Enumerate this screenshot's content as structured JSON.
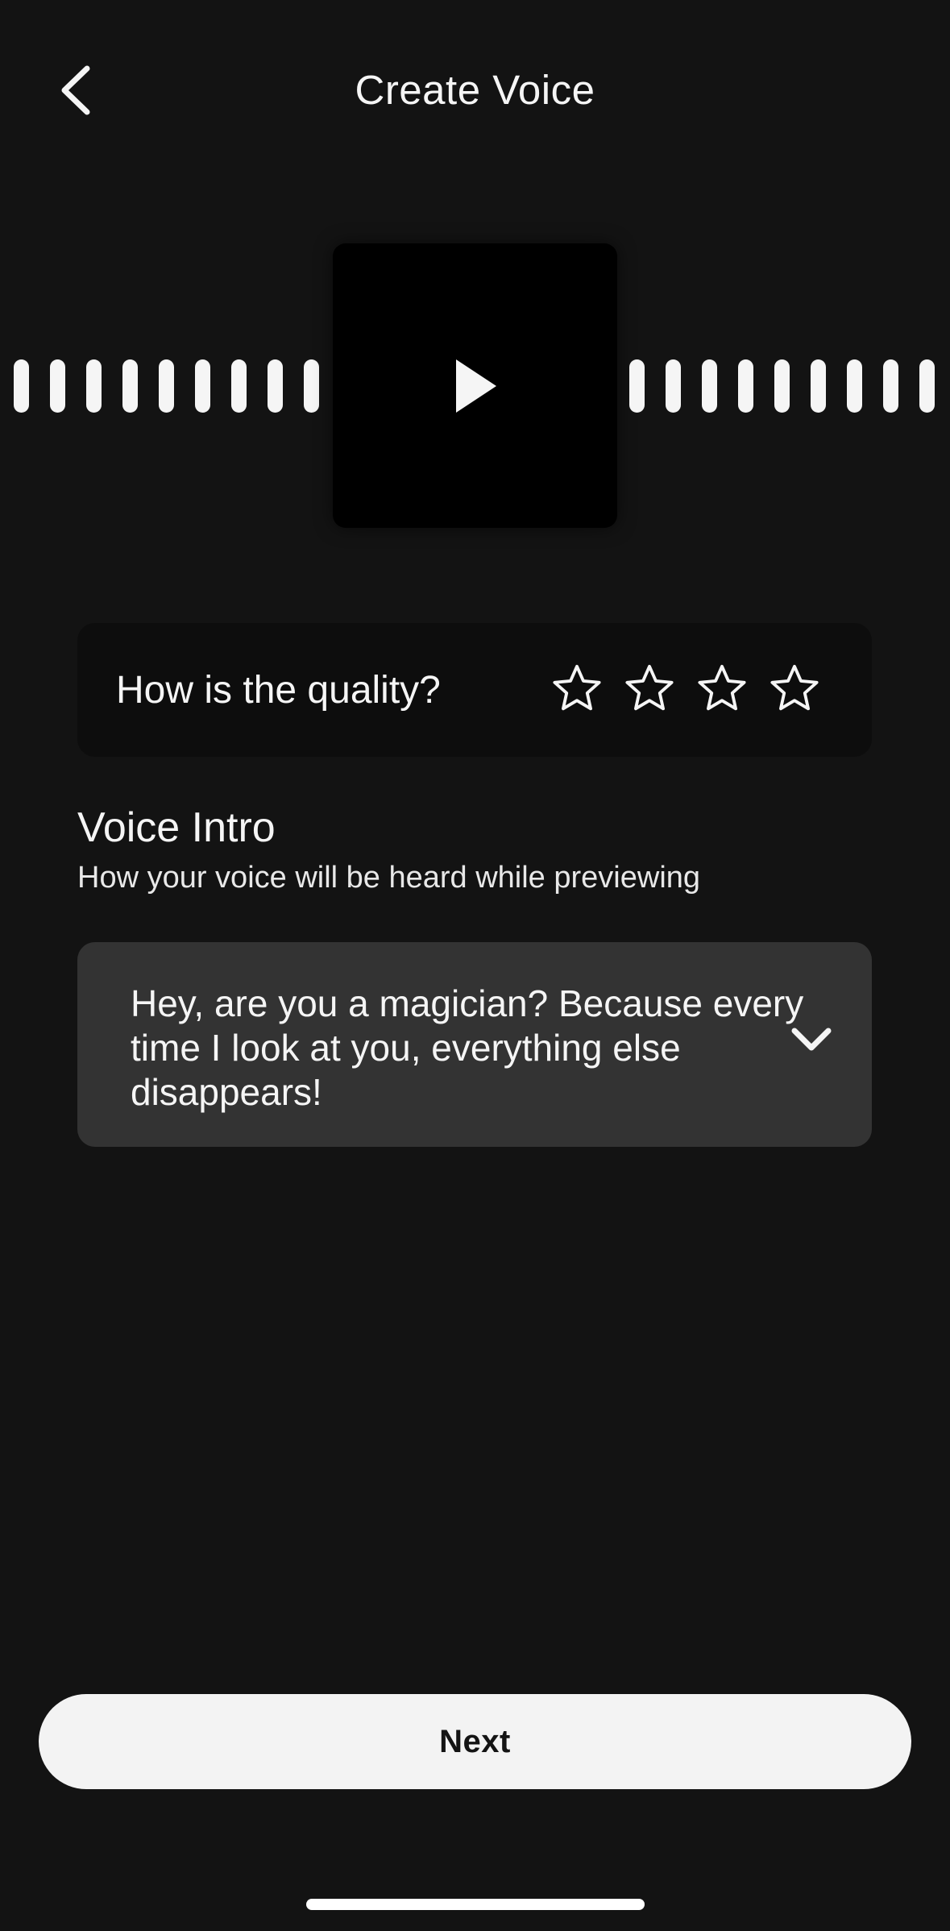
{
  "header": {
    "title": "Create Voice",
    "back_icon": "chevron-left-icon"
  },
  "player": {
    "play_icon": "play-icon",
    "waveform_left_bars": 9,
    "waveform_right_bars": 9
  },
  "rating": {
    "question": "How is the quality?",
    "max_stars": 4,
    "selected_stars": 0,
    "star_icon": "star-outline-icon"
  },
  "voice_intro": {
    "title": "Voice Intro",
    "subtitle": "How your voice will be heard while previewing",
    "selected_text": "Hey, are you a magician? Because every time I look at you, everything else disappears!",
    "dropdown_icon": "chevron-down-icon"
  },
  "footer": {
    "next_label": "Next"
  },
  "colors": {
    "background": "#131313",
    "card_dark": "#0d0d0d",
    "select_bg": "#333333",
    "button_bg": "#f3f3f3",
    "text_primary": "#f5f5f5"
  }
}
